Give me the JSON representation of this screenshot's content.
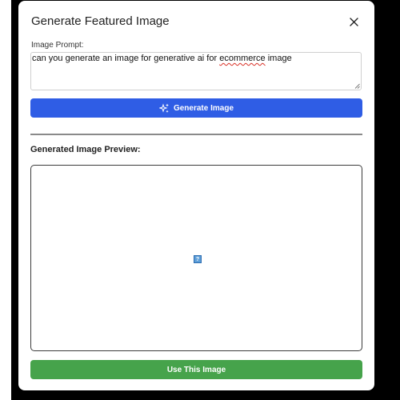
{
  "modal": {
    "title": "Generate Featured Image",
    "close_icon": "close-icon"
  },
  "prompt": {
    "label": "Image Prompt:",
    "value_before": "can you generate an image for generative ai for ",
    "value_misspelled": "ecommerce",
    "value_after": " image"
  },
  "generate_button": {
    "label": "Generate Image",
    "icon": "sparkles-icon",
    "color": "#2f5de5"
  },
  "preview": {
    "heading": "Generated Image Preview:",
    "broken_image_glyph": "?"
  },
  "use_button": {
    "label": "Use This Image",
    "color": "#46a34b"
  }
}
